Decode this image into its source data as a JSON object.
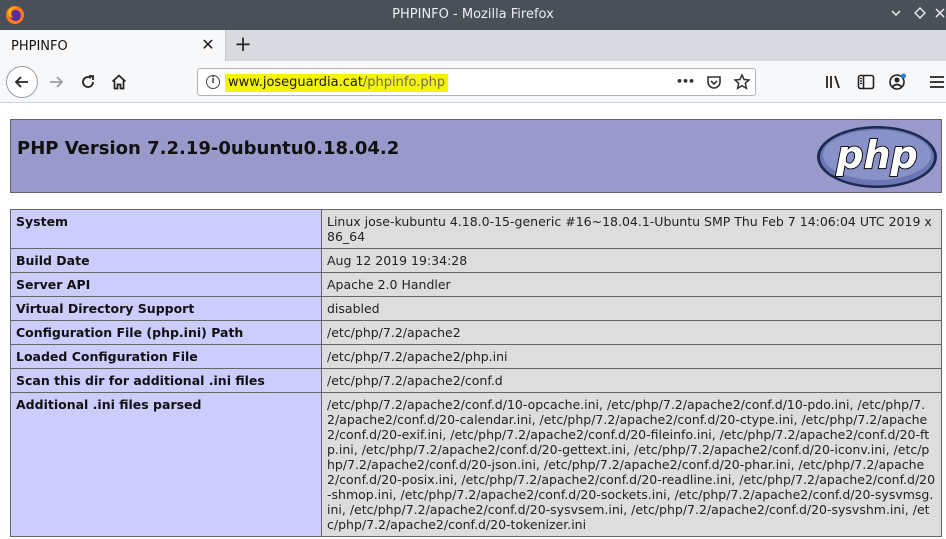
{
  "window": {
    "title": "PHPINFO - Mozilla Firefox",
    "controls": [
      "chevron-down",
      "diamond",
      "close"
    ]
  },
  "tab": {
    "title": "PHPINFO",
    "close_glyph": "✕",
    "new_tab_glyph": "+"
  },
  "urlbar": {
    "host": "www.joseguardia.cat",
    "path": "/phpinfo.php",
    "more_glyph": "•••"
  },
  "page": {
    "version_heading": "PHP Version 7.2.19-0ubuntu0.18.04.2",
    "logo_text": "php",
    "rows": [
      {
        "key": "System",
        "value": "Linux jose-kubuntu 4.18.0-15-generic #16~18.04.1-Ubuntu SMP Thu Feb 7 14:06:04 UTC 2019 x86_64"
      },
      {
        "key": "Build Date",
        "value": "Aug 12 2019 19:34:28"
      },
      {
        "key": "Server API",
        "value": "Apache 2.0 Handler"
      },
      {
        "key": "Virtual Directory Support",
        "value": "disabled"
      },
      {
        "key": "Configuration File (php.ini) Path",
        "value": "/etc/php/7.2/apache2"
      },
      {
        "key": "Loaded Configuration File",
        "value": "/etc/php/7.2/apache2/php.ini"
      },
      {
        "key": "Scan this dir for additional .ini files",
        "value": "/etc/php/7.2/apache2/conf.d"
      },
      {
        "key": "Additional .ini files parsed",
        "value": "/etc/php/7.2/apache2/conf.d/10-opcache.ini, /etc/php/7.2/apache2/conf.d/10-pdo.ini, /etc/php/7.2/apache2/conf.d/20-calendar.ini, /etc/php/7.2/apache2/conf.d/20-ctype.ini, /etc/php/7.2/apache2/conf.d/20-exif.ini, /etc/php/7.2/apache2/conf.d/20-fileinfo.ini, /etc/php/7.2/apache2/conf.d/20-ftp.ini, /etc/php/7.2/apache2/conf.d/20-gettext.ini, /etc/php/7.2/apache2/conf.d/20-iconv.ini, /etc/php/7.2/apache2/conf.d/20-json.ini, /etc/php/7.2/apache2/conf.d/20-phar.ini, /etc/php/7.2/apache2/conf.d/20-posix.ini, /etc/php/7.2/apache2/conf.d/20-readline.ini, /etc/php/7.2/apache2/conf.d/20-shmop.ini, /etc/php/7.2/apache2/conf.d/20-sockets.ini, /etc/php/7.2/apache2/conf.d/20-sysvmsg.ini, /etc/php/7.2/apache2/conf.d/20-sysvsem.ini, /etc/php/7.2/apache2/conf.d/20-sysvshm.ini, /etc/php/7.2/apache2/conf.d/20-tokenizer.ini"
      }
    ]
  },
  "colors": {
    "titlebar": "#4a5058",
    "php_header": "#9999cc",
    "key_cell": "#ccccff",
    "value_cell": "#dddddd",
    "url_highlight": "#f6f30a"
  },
  "icons": [
    "firefox-logo-icon",
    "back-arrow-icon",
    "forward-arrow-icon",
    "reload-icon",
    "home-icon",
    "info-icon",
    "more-actions-icon",
    "pocket-icon",
    "bookmark-star-icon",
    "library-icon",
    "sidebar-icon",
    "account-icon",
    "menu-icon",
    "php-logo"
  ]
}
